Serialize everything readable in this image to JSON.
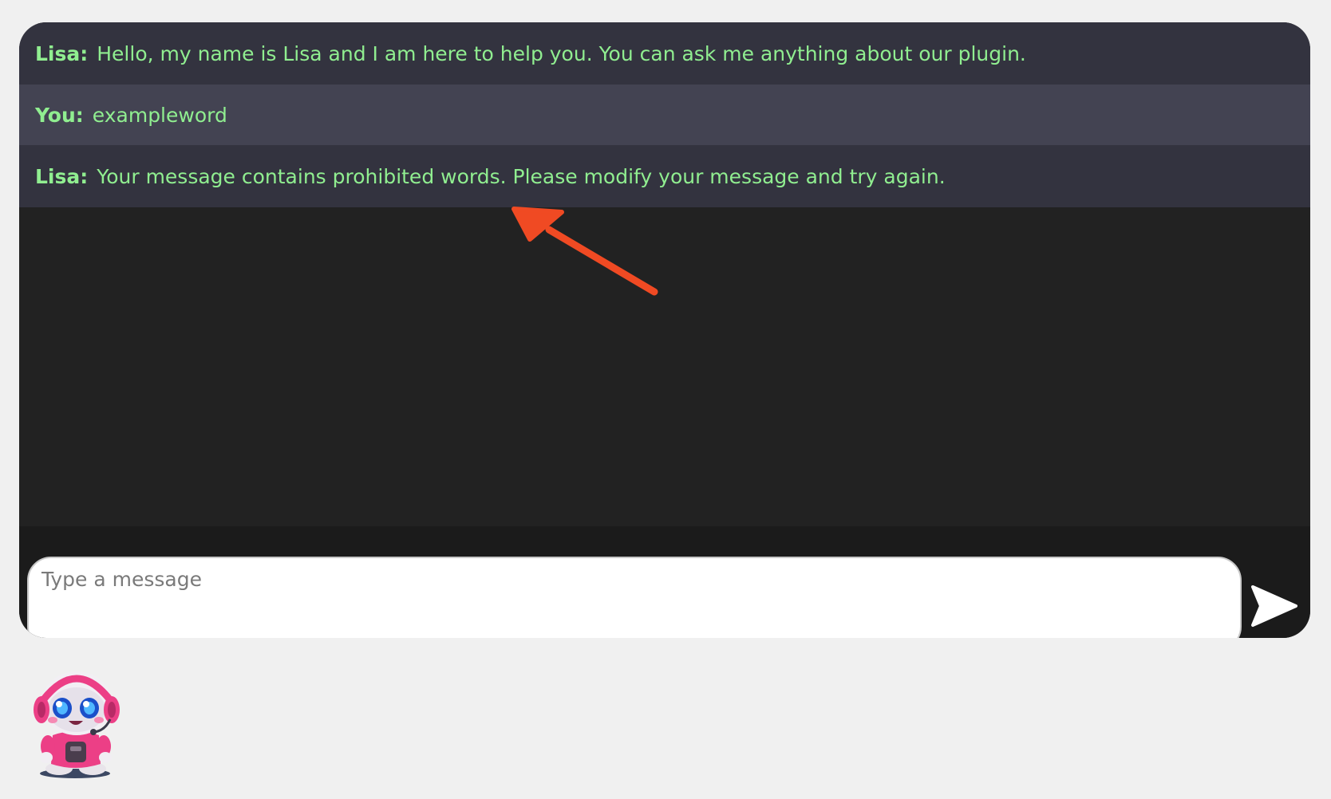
{
  "chat": {
    "messages": [
      {
        "sender": "Lisa:",
        "text": "Hello, my name is Lisa and I am here to help you. You can ask me anything about our plugin.",
        "role": "bot"
      },
      {
        "sender": "You:",
        "text": "exampleword",
        "role": "user"
      },
      {
        "sender": "Lisa:",
        "text": "Your message contains prohibited words. Please modify your message and try again.",
        "role": "bot"
      }
    ],
    "input": {
      "placeholder": "Type a message",
      "value": ""
    },
    "send_icon": "send-arrow-icon"
  },
  "colors": {
    "message_text": "#90ee90",
    "bot_row_bg": "#33333f",
    "user_row_bg": "#434352",
    "chat_bg": "#222222",
    "annotation_arrow": "#f04a23"
  },
  "avatar": {
    "icon": "robot-headset-avatar"
  }
}
